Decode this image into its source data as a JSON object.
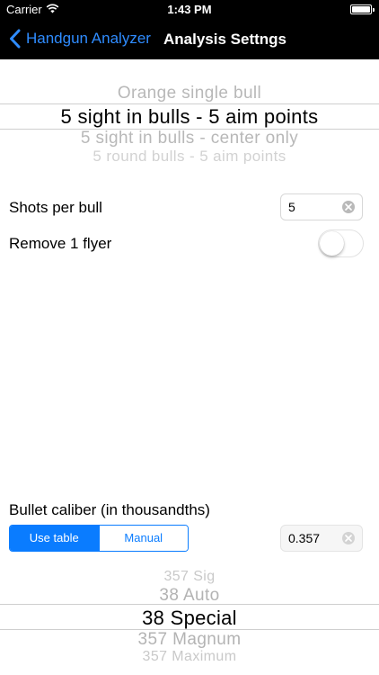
{
  "status_bar": {
    "carrier": "Carrier",
    "time": "1:43 PM",
    "icons": [
      "wifi-icon",
      "battery-icon"
    ]
  },
  "nav": {
    "back_label": "Handgun Analyzer",
    "title": "Analysis Settngs",
    "back_icon": "chevron-left-icon"
  },
  "target_picker": {
    "options": [
      "Orange single bull",
      "5 sight in bulls - 5 aim points",
      "5 sight in bulls - center only",
      "5 round bulls - 5 aim points"
    ],
    "selected": "5 sight in bulls - 5 aim points"
  },
  "shots_per_bull": {
    "label": "Shots per bull",
    "value": "5"
  },
  "remove_flyer": {
    "label": "Remove 1 flyer",
    "on": false
  },
  "bullet_caliber": {
    "label": "Bullet caliber (in thousandths)",
    "segments": [
      "Use table",
      "Manual"
    ],
    "selected_segment": "Use table",
    "value": "0.357"
  },
  "caliber_picker": {
    "options": [
      "357 Sig",
      "38 Auto",
      "38 Special",
      "357 Magnum",
      "357 Maximum"
    ],
    "selected": "38 Special"
  },
  "colors": {
    "accent": "#0a7cff",
    "nav_back": "#2f8cff",
    "nav_bg": "#000000"
  }
}
